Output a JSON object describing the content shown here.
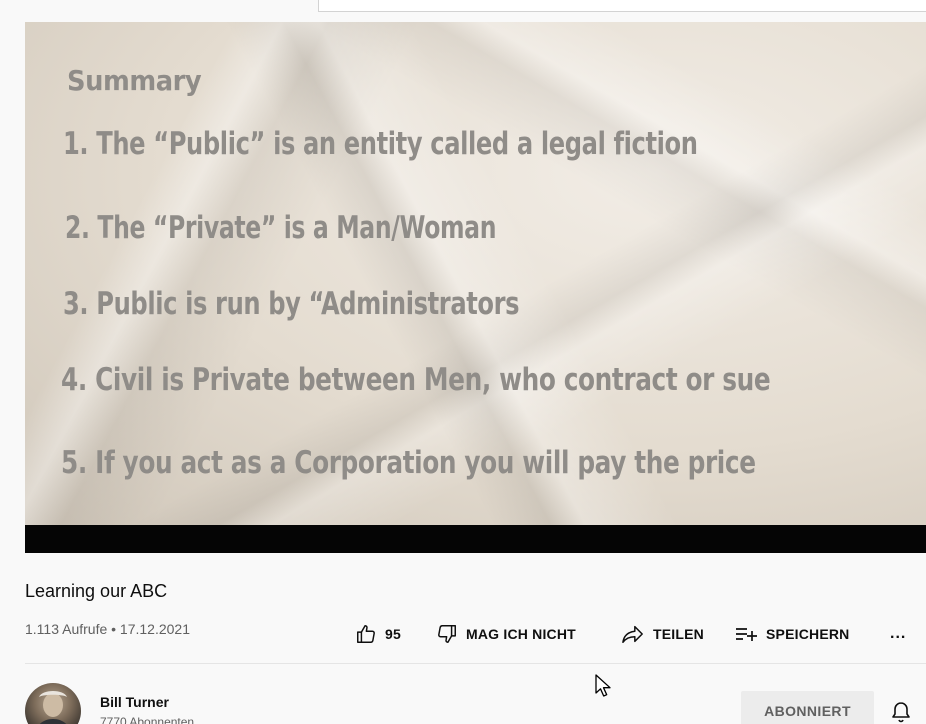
{
  "slide": {
    "title": "Summary",
    "points": [
      "1. The “Public” is an entity called a legal fiction",
      "2. The “Private” is a Man/Woman",
      "3. Public is run by “Administrators",
      "4. Civil is Private between Men, who contract or sue",
      "5. If you act as a Corporation you will pay the price"
    ]
  },
  "video": {
    "title": "Learning our ABC",
    "meta": "1.113 Aufrufe • 17.12.2021"
  },
  "actions": {
    "like_count": "95",
    "dislike_label": "MAG ICH NICHT",
    "share_label": "TEILEN",
    "save_label": "SPEICHERN",
    "more_label": "..."
  },
  "channel": {
    "name": "Bill Turner",
    "subscribers": "7770 Abonnenten",
    "subscribe_label": "ABONNIERT"
  },
  "icons": {
    "like": "thumbs-up-icon",
    "dislike": "thumbs-down-icon",
    "share": "share-arrow-icon",
    "save": "playlist-add-icon",
    "bell": "bell-icon",
    "cursor": "mouse-pointer-icon"
  }
}
